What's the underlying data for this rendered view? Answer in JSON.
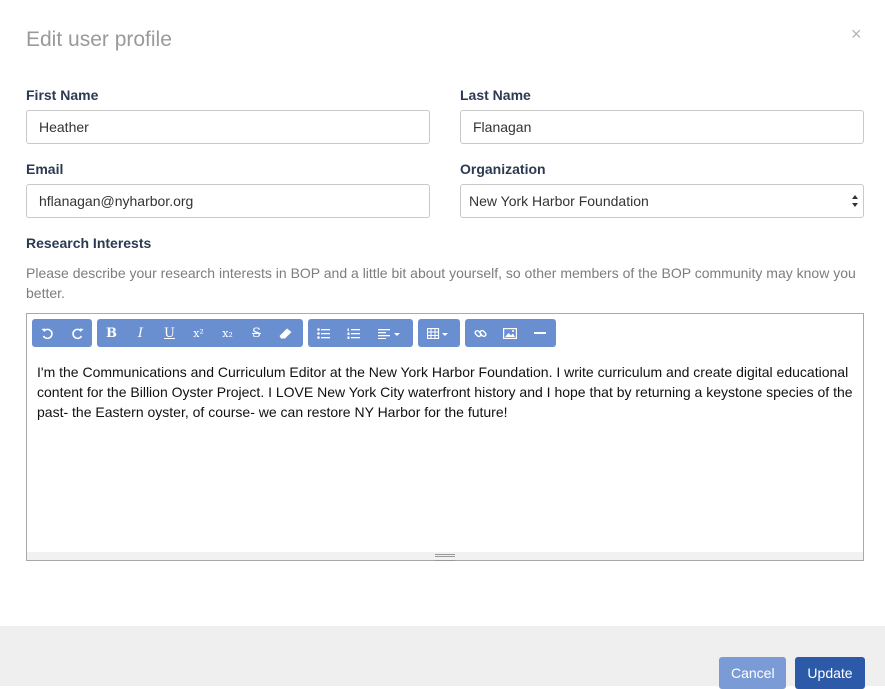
{
  "modal": {
    "title": "Edit user profile",
    "close": "×"
  },
  "form": {
    "first_name": {
      "label": "First Name",
      "value": "Heather"
    },
    "last_name": {
      "label": "Last Name",
      "value": "Flanagan"
    },
    "email": {
      "label": "Email",
      "value": "hflanagan@nyharbor.org"
    },
    "organization": {
      "label": "Organization",
      "value": "New York Harbor Foundation"
    },
    "research": {
      "label": "Research Interests",
      "help": "Please describe your research interests in BOP and a little bit about yourself, so other members of the BOP community may know you better.",
      "content": "I'm the Communications and Curriculum Editor at the New York Harbor Foundation.  I write curriculum and create digital educational content for the Billion Oyster Project.  I LOVE New York City waterfront history and I hope that by returning a keystone species of the past- the Eastern oyster, of course- we can restore NY Harbor for the future!"
    }
  },
  "toolbar": {
    "bold": "B",
    "italic": "I",
    "underline": "U",
    "superscript": "x²",
    "subscript": "x₂",
    "strikethrough": "S"
  },
  "colors": {
    "toolbar": "#6a8fd0",
    "primary": "#2d5aa8",
    "secondary": "#7a9bd5"
  },
  "buttons": {
    "cancel": "Cancel",
    "update": "Update"
  }
}
